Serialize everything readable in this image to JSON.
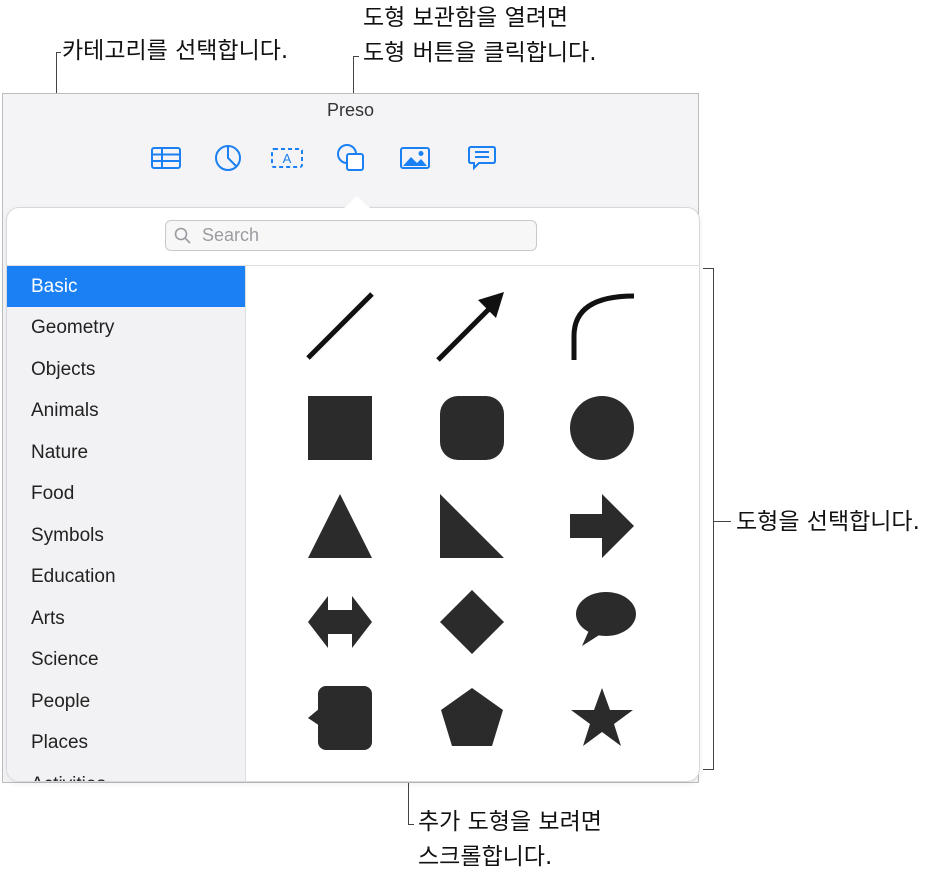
{
  "callouts": {
    "select_category": "카테고리를 선택합니다.",
    "shapes_button_line1": "도형 보관함을 열려면",
    "shapes_button_line2": "도형 버튼을 클릭합니다.",
    "select_shape": "도형을 선택합니다.",
    "scroll_line1": "추가 도형을 보려면",
    "scroll_line2": "스크롤합니다."
  },
  "window": {
    "title": "Preso"
  },
  "toolbar": {
    "buttons": [
      {
        "icon": "table-icon"
      },
      {
        "icon": "chart-icon"
      },
      {
        "icon": "text-icon",
        "glyph": "A"
      },
      {
        "icon": "shape-icon"
      },
      {
        "icon": "media-icon"
      },
      {
        "icon": "comment-icon"
      }
    ]
  },
  "search": {
    "placeholder": "Search"
  },
  "sidebar": {
    "selected": "Basic",
    "items": [
      "Basic",
      "Geometry",
      "Objects",
      "Animals",
      "Nature",
      "Food",
      "Symbols",
      "Education",
      "Arts",
      "Science",
      "People",
      "Places",
      "Activities"
    ]
  },
  "shapes": [
    "line",
    "arrow-line",
    "curve",
    "square",
    "rounded-square",
    "circle",
    "triangle",
    "right-triangle",
    "arrow",
    "double-arrow",
    "diamond",
    "speech-bubble",
    "callout-box",
    "pentagon",
    "star"
  ],
  "colors": {
    "accent": "#1a80f4",
    "shape_fill": "#2b2b2b",
    "toolbar_icon": "#1a80f4"
  }
}
